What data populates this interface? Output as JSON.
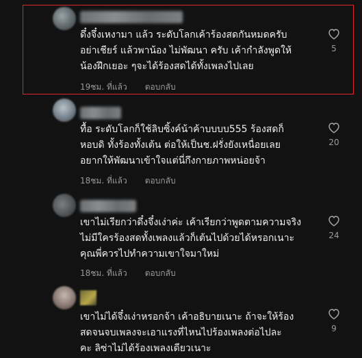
{
  "comments": [
    {
      "text": "ดึ๋งจึ๋งเหงามา แล้ว ระดับโลกเค้าร้องสดกันหมดครับ\nอย่าเชียร์ แล้วพาน้อง ไม่พัฒนา ครับ เค้ากำลังพูดให้\nน้องฝึกเยอะ ๆจะได้ร้องสดได้ทั้งเพลงไปเลย",
      "time": "19ชม. ที่แล้ว",
      "reply": "ตอบกลับ",
      "likes": "5"
    },
    {
      "text": "ทื้อ ระดับโลกก็ใช้ลิบซิ้งค์น้าค้าบบบบ555 ร้องสดก็\nหอบดิ ทั้งร้องทั้งเต้น ต่อให้เป็นช.ฝรั่งยังเหนื่อยเลย\nอยากให้พัฒนาเข้าใจแต่นี่กึงกายภาพหน่อยจ้า",
      "time": "18ชม. ที่แล้ว",
      "reply": "ตอบกลับ",
      "likes": "20"
    },
    {
      "text": "เขาไม่เรียกว่าดึ๋งจึ๋งเง่าค่ะ เค้าเรียกว่าพูดตามความจริง\nไม่มีใครร้องสดทั้งเพลงแล้วก็เต้นไปด้วยได้หรอกเนาะ\nคุณพี่ควรไปทำความเขาใจมาใหม่",
      "time": "18ชม. ที่แล้ว",
      "reply": "ตอบกลับ",
      "likes": "24"
    },
    {
      "text": "เขาไม่ได้จึ๋งเง่าหรอกจ้า เค้าอธิบายเนาะ ถ้าจะให้ร้อง\nสดจนจบเพลงจะเอาแรงที่ไหนไปร้องเพลงต่อไปละ\nคะ ลิซ่าไม่ได้ร้องเพลงเดียวเนาะ",
      "likes": "9"
    }
  ]
}
